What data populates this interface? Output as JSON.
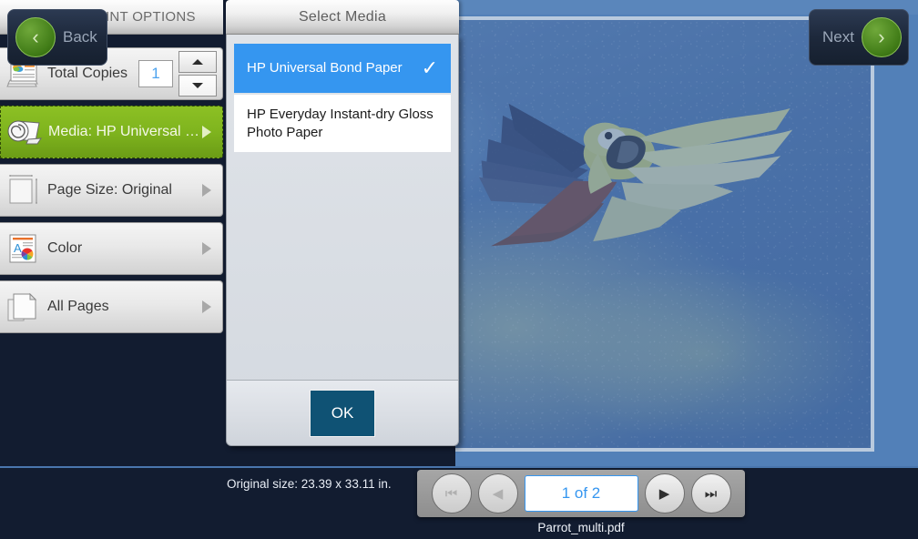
{
  "left_panel": {
    "title": "SELECT PRINT OPTIONS",
    "options": [
      {
        "label": "Total Copies",
        "icon": "copies-icon",
        "type": "stepper",
        "value": "1",
        "selected": false
      },
      {
        "label": "Media: HP Universal Bo...",
        "icon": "media-roll-icon",
        "type": "nav",
        "selected": true
      },
      {
        "label": "Page Size: Original",
        "icon": "page-size-icon",
        "type": "nav",
        "selected": false
      },
      {
        "label": "Color",
        "icon": "color-icon",
        "type": "nav",
        "selected": false
      },
      {
        "label": "All Pages",
        "icon": "all-pages-icon",
        "type": "nav",
        "selected": false
      }
    ]
  },
  "media_panel": {
    "title": "Select Media",
    "items": [
      {
        "label": "HP Universal Bond Paper",
        "selected": true,
        "check": "✓"
      },
      {
        "label": "HP Everyday Instant-dry Gloss Photo Paper",
        "selected": false,
        "check": ""
      }
    ],
    "ok_label": "OK"
  },
  "preview": {
    "image_alt": "parrot-photo-preview"
  },
  "bottom_bar": {
    "back_label": "Back",
    "next_label": "Next",
    "back_icon": "‹",
    "next_icon": "›",
    "original_size": "Original size: 23.39 x 33.11 in.",
    "page_indicator": "1 of 2",
    "filename": "Parrot_multi.pdf",
    "pager_buttons": [
      {
        "name": "first-page-button",
        "glyph": "⏮",
        "disabled": true
      },
      {
        "name": "previous-page-button",
        "glyph": "◀",
        "disabled": true
      },
      {
        "name": "next-page-button",
        "glyph": "▶",
        "disabled": false
      },
      {
        "name": "last-page-button",
        "glyph": "⏭",
        "disabled": false
      }
    ]
  },
  "colors": {
    "accent_blue": "#3596f0",
    "selected_green": "#7fb41e",
    "dark_navy": "#121c30",
    "ok_button": "#0f5274"
  }
}
